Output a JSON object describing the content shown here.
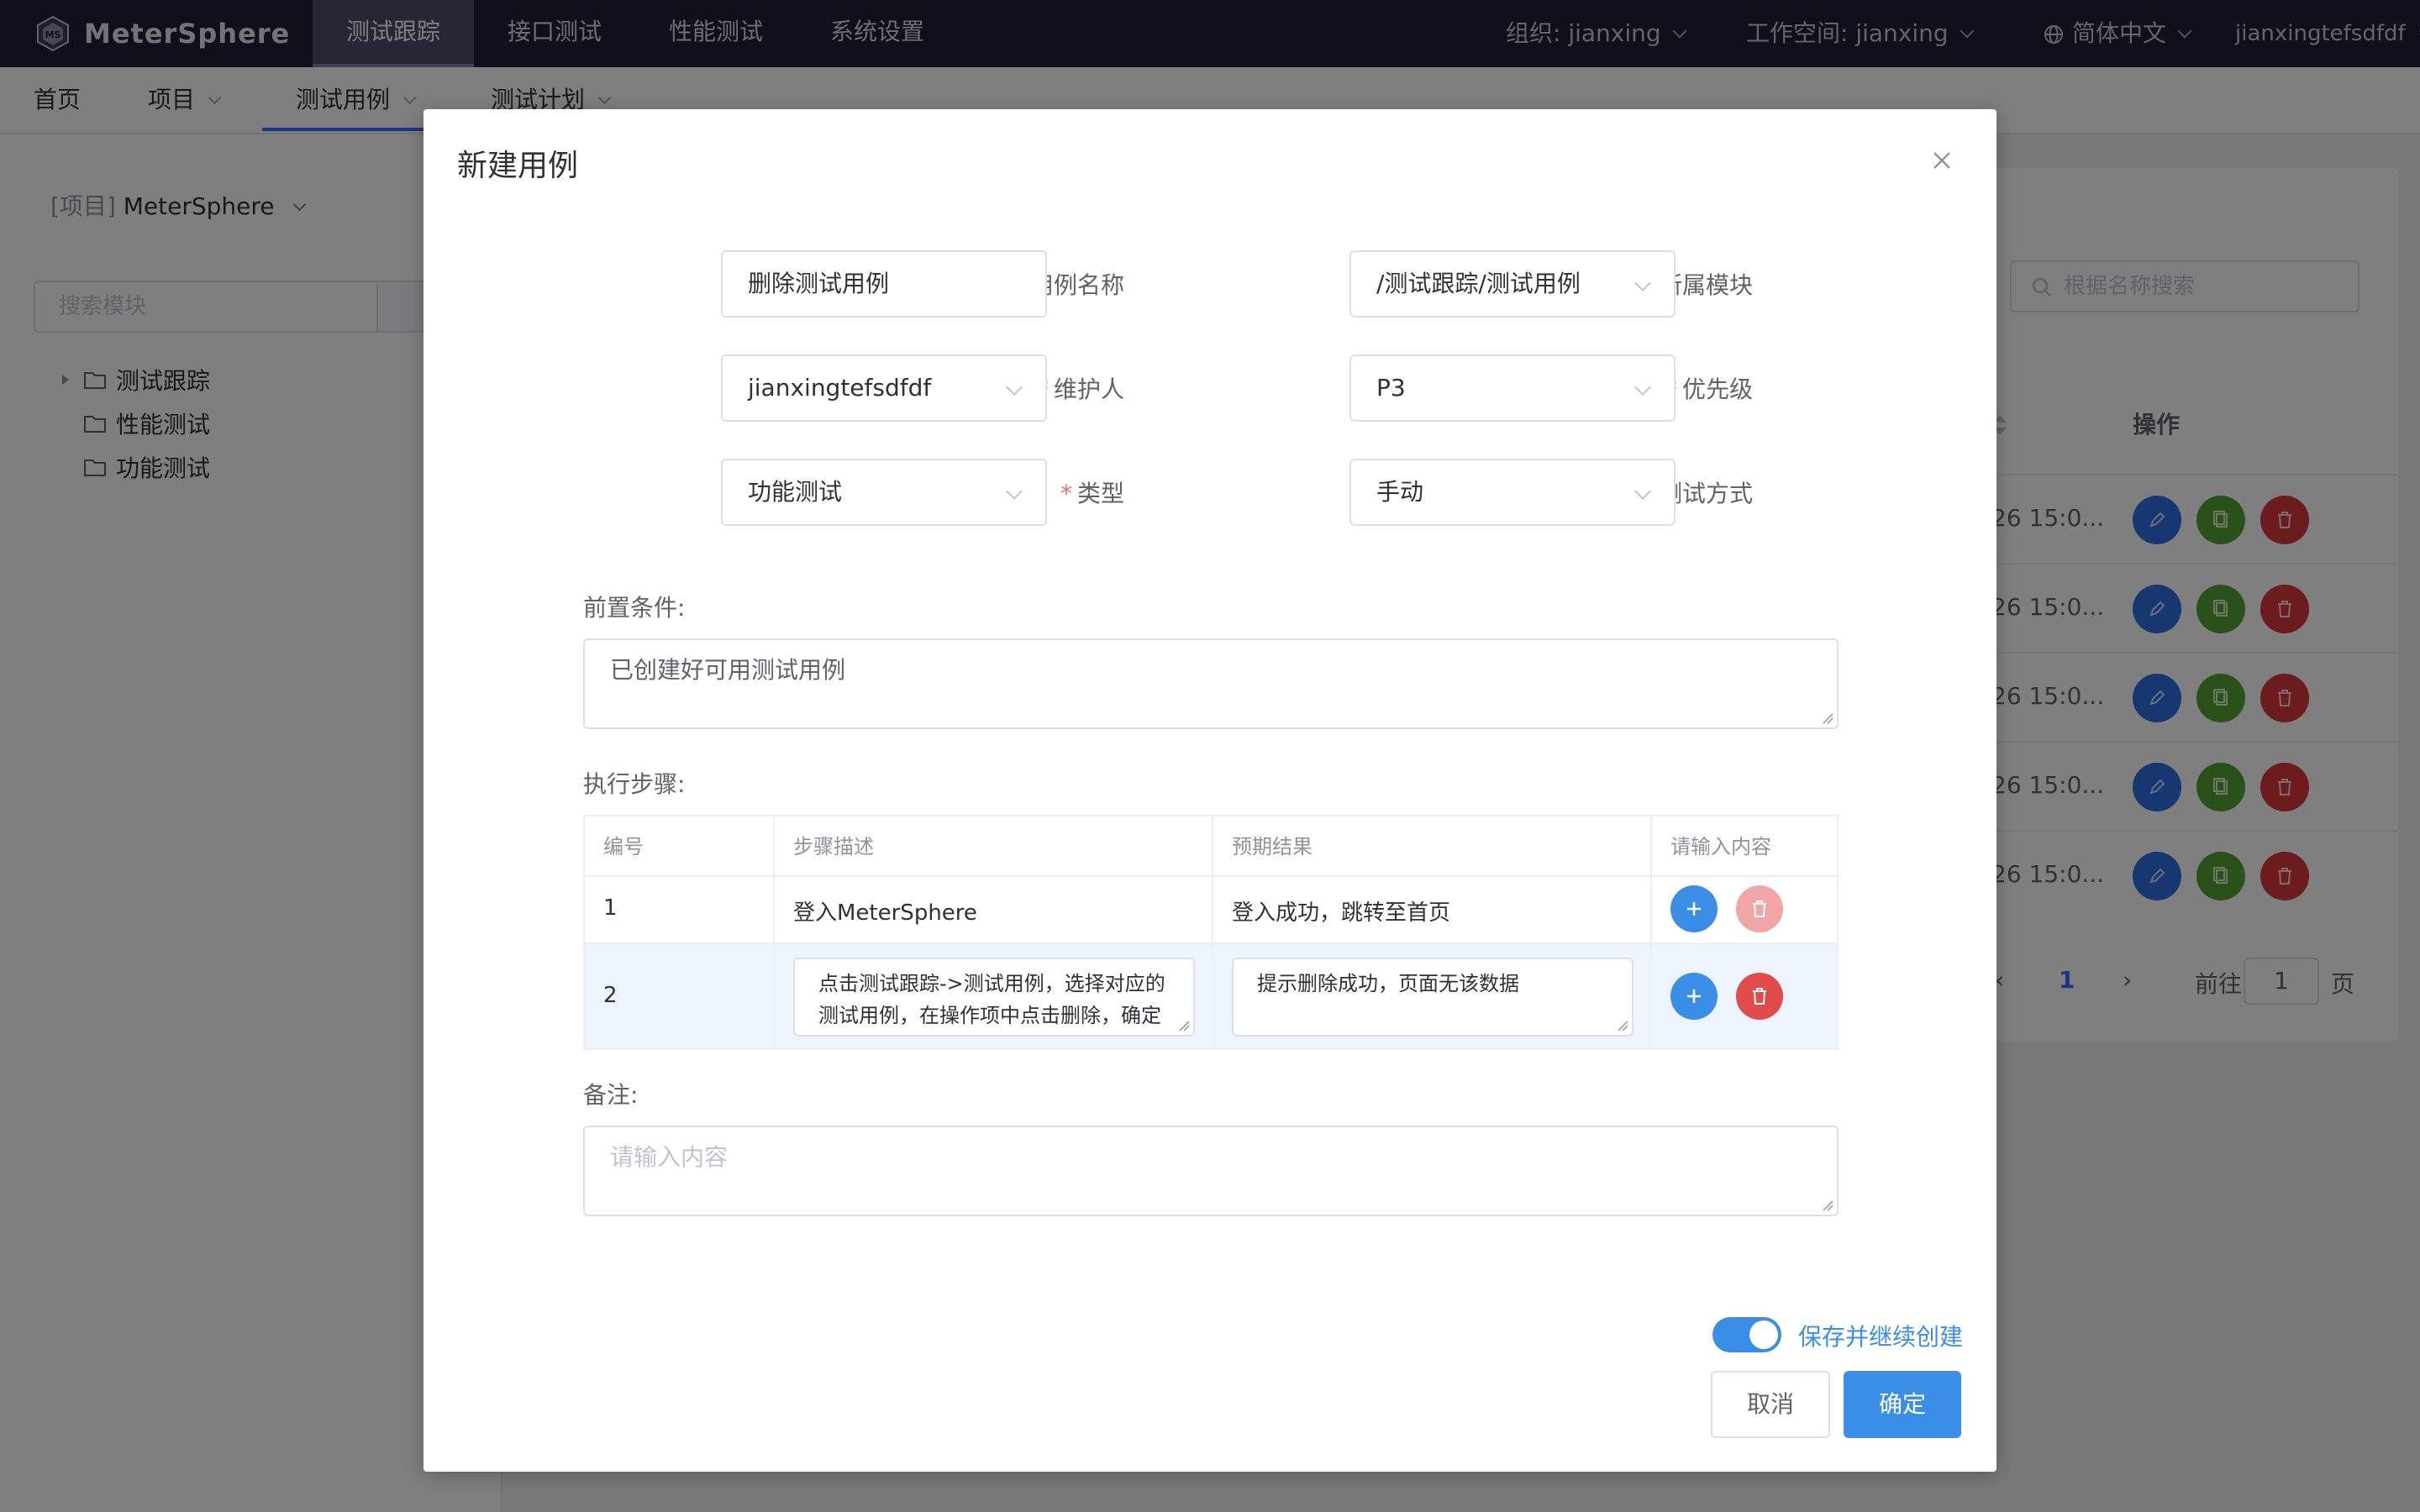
{
  "brand": {
    "name": "MeterSphere"
  },
  "topnav": {
    "items": [
      "测试跟踪",
      "接口测试",
      "性能测试",
      "系统设置"
    ],
    "org": "组织: jianxing",
    "workspace": "工作空间: jianxing",
    "language": "简体中文",
    "user": "jianxingtefsdfdf"
  },
  "subnav": {
    "items": [
      "首页",
      "项目",
      "测试用例",
      "测试计划"
    ]
  },
  "sidebar": {
    "project_prefix": "[项目]",
    "project_name": "MeterSphere",
    "search_placeholder": "搜索模块",
    "tree": [
      "测试跟踪",
      "性能测试",
      "功能测试"
    ]
  },
  "background_list": {
    "search_placeholder": "根据名称搜索",
    "ops_header": "操作",
    "row_times": [
      "26 15:0...",
      "26 15:0...",
      "26 15:0...",
      "26 15:0...",
      "26 15:0..."
    ],
    "pager": {
      "current": "1",
      "goto_label": "前往",
      "goto_value": "1",
      "page_suffix": "页"
    }
  },
  "dialog": {
    "title": "新建用例",
    "fields": {
      "name_label": "用例名称",
      "name_value": "删除测试用例",
      "module_label": "所属模块",
      "module_value": "/测试跟踪/测试用例",
      "maintainer_label": "维护人",
      "maintainer_value": "jianxingtefsdfdf",
      "priority_label": "优先级",
      "priority_value": "P3",
      "type_label": "类型",
      "type_value": "功能测试",
      "method_label": "测试方式",
      "method_value": "手动"
    },
    "precondition": {
      "label": "前置条件:",
      "value": "已创建好可用测试用例"
    },
    "steps": {
      "label": "执行步骤:",
      "headers": [
        "编号",
        "步骤描述",
        "预期结果",
        "请输入内容"
      ],
      "rows": [
        {
          "num": "1",
          "desc": "登入MeterSphere",
          "expected": "登入成功，跳转至首页"
        },
        {
          "num": "2",
          "desc_line1": "点击测试跟踪->测试用例，选择对应的",
          "desc_line2": "测试用例，在操作项中点击删除，确定",
          "expected": "提示删除成功，页面无该数据"
        }
      ]
    },
    "remark": {
      "label": "备注:",
      "placeholder": "请输入内容"
    },
    "continue_label": "保存并继续创建",
    "continue_on": true,
    "cancel_label": "取消",
    "ok_label": "确定"
  },
  "colors": {
    "header_bg": "#1f2139",
    "primary": "#3a8ee6",
    "required": "#f56c6c",
    "edit": "#2f6ee0",
    "copy": "#55a232",
    "delete": "#d9383a"
  }
}
